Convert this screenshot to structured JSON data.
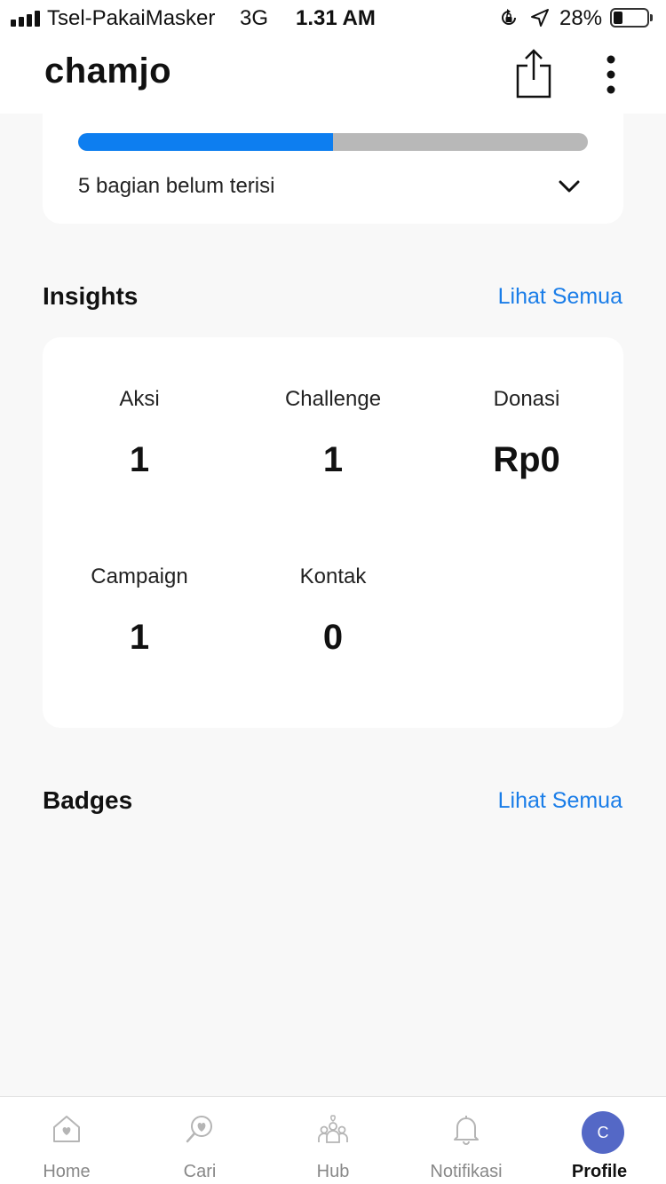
{
  "status_bar": {
    "carrier": "Tsel-PakaiMasker",
    "network": "3G",
    "time": "1.31 AM",
    "battery": "28%",
    "battery_level": 0.28,
    "icons": [
      "signal-bars-icon",
      "rotation-lock-icon",
      "location-arrow-icon",
      "battery-icon"
    ]
  },
  "header": {
    "title": "chamjo",
    "icons": [
      "share-icon",
      "more-vertical-icon"
    ]
  },
  "profile_completion": {
    "progress": 0.5,
    "text": "5 bagian belum terisi",
    "icon": "chevron-down-icon"
  },
  "insights": {
    "title": "Insights",
    "see_all": "Lihat Semua",
    "stats": [
      {
        "label": "Aksi",
        "value": "1"
      },
      {
        "label": "Challenge",
        "value": "1"
      },
      {
        "label": "Donasi",
        "value": "Rp0"
      },
      {
        "label": "Campaign",
        "value": "1"
      },
      {
        "label": "Kontak",
        "value": "0"
      }
    ]
  },
  "badges": {
    "title": "Badges",
    "see_all": "Lihat Semua"
  },
  "tab_bar": {
    "tabs": [
      {
        "label": "Home",
        "icon": "home-heart-icon",
        "active": false
      },
      {
        "label": "Cari",
        "icon": "search-heart-icon",
        "active": false
      },
      {
        "label": "Hub",
        "icon": "people-group-icon",
        "active": false
      },
      {
        "label": "Notifikasi",
        "icon": "bell-icon",
        "active": false
      },
      {
        "label": "Profile",
        "icon": "avatar",
        "active": true,
        "avatar_initial": "C"
      }
    ]
  },
  "colors": {
    "accent": "#1a7de8",
    "progress_fill": "#0d7ef0",
    "progress_track": "#b8b8b8",
    "avatar": "#5468c6",
    "background": "#f8f8f8"
  }
}
